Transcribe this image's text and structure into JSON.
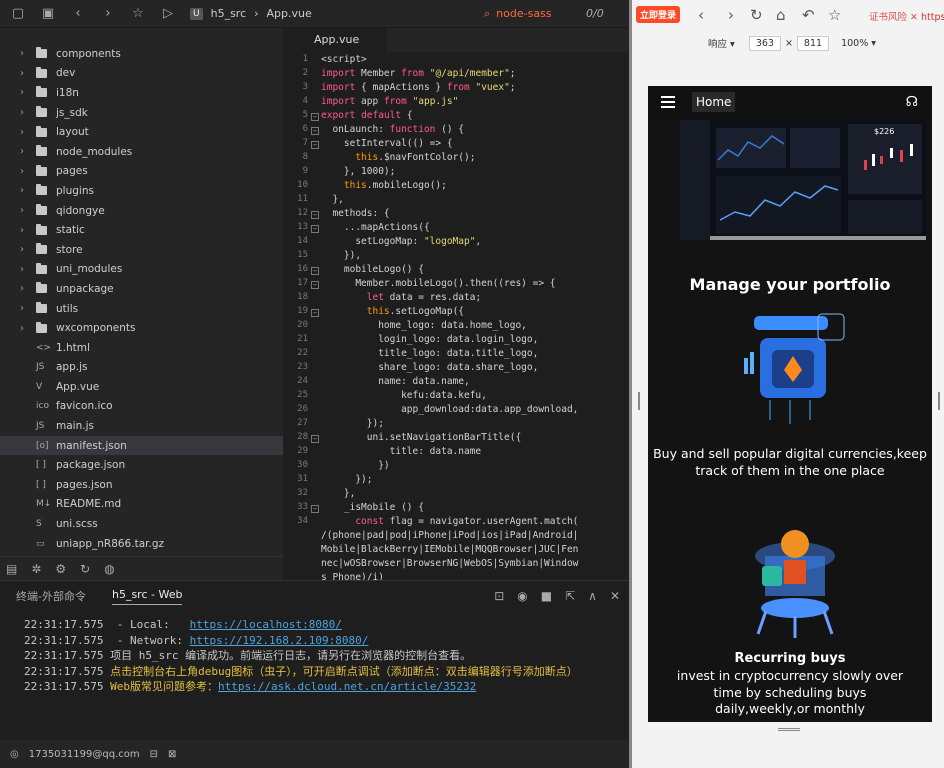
{
  "ide": {
    "breadcrumb": [
      "h5_src",
      "App.vue"
    ],
    "node_label": "node-sass",
    "ratio": "0/0",
    "tab": "App.vue"
  },
  "files": [
    {
      "type": "folder",
      "name": "components"
    },
    {
      "type": "folder",
      "name": "dev"
    },
    {
      "type": "folder",
      "name": "i18n"
    },
    {
      "type": "folder",
      "name": "js_sdk"
    },
    {
      "type": "folder",
      "name": "layout"
    },
    {
      "type": "folder",
      "name": "node_modules"
    },
    {
      "type": "folder",
      "name": "pages"
    },
    {
      "type": "folder",
      "name": "plugins"
    },
    {
      "type": "folder",
      "name": "qidongye"
    },
    {
      "type": "folder",
      "name": "static"
    },
    {
      "type": "folder",
      "name": "store"
    },
    {
      "type": "folder",
      "name": "uni_modules"
    },
    {
      "type": "folder",
      "name": "unpackage"
    },
    {
      "type": "folder",
      "name": "utils"
    },
    {
      "type": "folder",
      "name": "wxcomponents"
    },
    {
      "type": "file",
      "icon": "<>",
      "name": "1.html"
    },
    {
      "type": "file",
      "icon": "JS",
      "name": "app.js"
    },
    {
      "type": "file",
      "icon": "V",
      "name": "App.vue"
    },
    {
      "type": "file",
      "icon": "ico",
      "name": "favicon.ico"
    },
    {
      "type": "file",
      "icon": "JS",
      "name": "main.js"
    },
    {
      "type": "file",
      "icon": "[o]",
      "name": "manifest.json",
      "selected": true
    },
    {
      "type": "file",
      "icon": "[ ]",
      "name": "package.json"
    },
    {
      "type": "file",
      "icon": "[ ]",
      "name": "pages.json"
    },
    {
      "type": "file",
      "icon": "M↓",
      "name": "README.md"
    },
    {
      "type": "file",
      "icon": "S",
      "name": "uni.scss"
    },
    {
      "type": "file",
      "icon": "▭",
      "name": "uniapp_nR866.tar.gz"
    }
  ],
  "code": [
    "<script>",
    "import Member from \"@/api/member\";",
    "import { mapActions } from \"vuex\";",
    "import app from \"app.js\"",
    "export default {",
    "  onLaunch: function () {",
    "    setInterval(() => {",
    "      this.$navFontColor();",
    "    }, 1000);",
    "    this.mobileLogo();",
    "  },",
    "  methods: {",
    "    ...mapActions({",
    "      setLogoMap: \"logoMap\",",
    "    }),",
    "    mobileLogo() {",
    "      Member.mobileLogo().then((res) => {",
    "        let data = res.data;",
    "        this.setLogoMap({",
    "          home_logo: data.home_logo,",
    "          login_logo: data.login_logo,",
    "          title_logo: data.title_logo,",
    "          share_logo: data.share_logo,",
    "          name: data.name,",
    "              kefu:data.kefu,",
    "              app_download:data.app_download,",
    "        });",
    "        uni.setNavigationBarTitle({",
    "            title: data.name",
    "          })",
    "      });",
    "    },",
    "    _isMobile () {",
    "      const flag = navigator.userAgent.match(",
    "/(phone|pad|pod|iPhone|iPod|ios|iPad|Android|",
    "Mobile|BlackBerry|IEMobile|MQQBrowser|JUC|Fen",
    "nec|wOSBrowser|BrowserNG|WebOS|Symbian|Window",
    "s Phone)/i)"
  ],
  "line_numbers": [
    "1",
    "2",
    "3",
    "4",
    "5",
    "6",
    "7",
    "8",
    "9",
    "10",
    "11",
    "12",
    "13",
    "14",
    "15",
    "16",
    "17",
    "18",
    "19",
    "20",
    "21",
    "22",
    "23",
    "24",
    "25",
    "26",
    "27",
    "28",
    "29",
    "30",
    "31",
    "32",
    "33",
    "34",
    "",
    "",
    "",
    ""
  ],
  "terminal": {
    "tabs": [
      "终端-外部命令",
      "h5_src - Web"
    ],
    "lines": [
      {
        "time": "22:31:17.575",
        "text": "  - Local:   ",
        "url": "https://localhost:8080/"
      },
      {
        "time": "22:31:17.575",
        "text": "  - Network: ",
        "url": "https://192.168.2.109:8080/"
      },
      {
        "time": "22:31:17.575",
        "text": "项目 h5_src 编译成功。前端运行日志，请另行在浏览器的控制台查看。"
      },
      {
        "time": "22:31:17.575",
        "yellow": "点击控制台右上角debug图标（虫子），可开启断点调试（添加断点：双击编辑器行号添加断点）"
      },
      {
        "time": "22:31:17.575",
        "yellow": "Web版常见问题参考：",
        "url": "https://ask.dcloud.net.cn/article/35232"
      }
    ]
  },
  "status": {
    "user": "1735031199@qq.com"
  },
  "browser": {
    "login": "立即登录",
    "trust": "证书风险",
    "mode": "响应",
    "width": "363",
    "height": "811",
    "zoom": "100%",
    "app": {
      "home": "Home",
      "laptop_price": "$226",
      "title": "Manage your portfolio",
      "desc1": "Buy and sell popular digital currencies,keep track of them in the one place",
      "subtitle2": "Recurring buys",
      "desc2": "invest in cryptocurrency slowly over time by scheduling buys daily,weekly,or monthly"
    }
  },
  "colors": {
    "accent": "#ff6a3d",
    "link": "#4fa3d8",
    "warn": "#e0c040"
  }
}
